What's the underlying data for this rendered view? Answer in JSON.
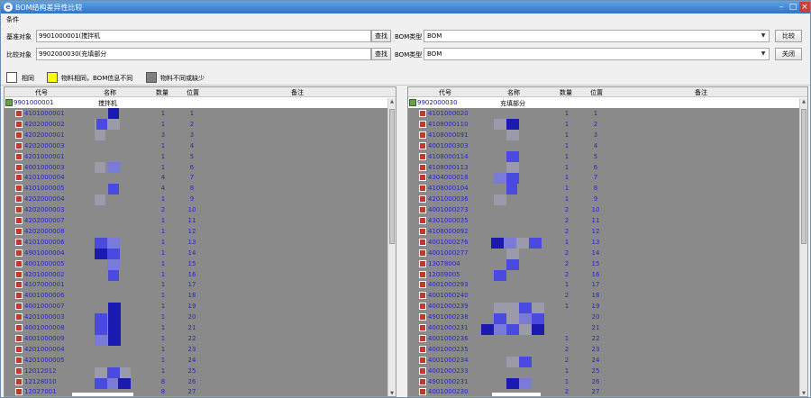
{
  "window": {
    "title": "BOM结构差异性比较",
    "minimize": "–",
    "maximize": "□",
    "close": "×"
  },
  "conditions": {
    "section_label": "条件",
    "base_label": "基准对象",
    "base_value": "9901000001(搅拌机",
    "compare_label": "比较对象",
    "compare_value": "9902000030(充填部分",
    "find_label": "查找",
    "bom_type_label": "BOM类型",
    "bom_type_value": "BOM",
    "compare_button": "比较",
    "close_button": "关闭"
  },
  "legend": [
    {
      "label": "相同",
      "color": "#ffffff"
    },
    {
      "label": "物料相同，BOM信息不同",
      "color": "#ffff00"
    },
    {
      "label": "物料不同或缺少",
      "color": "#808080"
    }
  ],
  "columns": {
    "code": "代号",
    "name": "名称",
    "qty": "数量",
    "pos": "位置",
    "remark": "备注"
  },
  "left_panel": {
    "root_code": "9901000001",
    "root_name": "搅拌机",
    "rows": [
      {
        "code": "4101000001",
        "qty": "1",
        "pos": "1"
      },
      {
        "code": "4202000002",
        "qty": "1",
        "pos": "2"
      },
      {
        "code": "4202000001",
        "qty": "3",
        "pos": "3"
      },
      {
        "code": "4202000003",
        "qty": "1",
        "pos": "4"
      },
      {
        "code": "4201000001",
        "qty": "1",
        "pos": "5"
      },
      {
        "code": "4001000003",
        "qty": "1",
        "pos": "6"
      },
      {
        "code": "4101000004",
        "qty": "4",
        "pos": "7"
      },
      {
        "code": "4101000005",
        "qty": "4",
        "pos": "8"
      },
      {
        "code": "4202000004",
        "qty": "1",
        "pos": "9"
      },
      {
        "code": "4202000003",
        "qty": "2",
        "pos": "10"
      },
      {
        "code": "4202000007",
        "qty": "1",
        "pos": "11"
      },
      {
        "code": "4202000008",
        "qty": "1",
        "pos": "12"
      },
      {
        "code": "4101000006",
        "qty": "1",
        "pos": "13"
      },
      {
        "code": "4901000004",
        "qty": "1",
        "pos": "14"
      },
      {
        "code": "4001000005",
        "qty": "1",
        "pos": "15"
      },
      {
        "code": "4201000002",
        "qty": "1",
        "pos": "16"
      },
      {
        "code": "4107000001",
        "qty": "1",
        "pos": "17"
      },
      {
        "code": "4001000006",
        "qty": "1",
        "pos": "18"
      },
      {
        "code": "4001000007",
        "qty": "1",
        "pos": "19"
      },
      {
        "code": "4201000003",
        "qty": "1",
        "pos": "20"
      },
      {
        "code": "4001000008",
        "qty": "1",
        "pos": "21"
      },
      {
        "code": "4001000009",
        "qty": "1",
        "pos": "22"
      },
      {
        "code": "4201000004",
        "qty": "1",
        "pos": "23"
      },
      {
        "code": "4201000005",
        "qty": "1",
        "pos": "24"
      },
      {
        "code": "12012012",
        "qty": "1",
        "pos": "25"
      },
      {
        "code": "12128010",
        "qty": "8",
        "pos": "26"
      },
      {
        "code": "12027001",
        "qty": "8",
        "pos": "27"
      }
    ]
  },
  "right_panel": {
    "root_code": "9902000030",
    "root_name": "充填部分",
    "rows": [
      {
        "code": "4101000020",
        "qty": "1",
        "pos": "1"
      },
      {
        "code": "4108000110",
        "qty": "1",
        "pos": "2"
      },
      {
        "code": "4108000091",
        "qty": "1",
        "pos": "3"
      },
      {
        "code": "4001000303",
        "qty": "1",
        "pos": "4"
      },
      {
        "code": "4108000114",
        "qty": "1",
        "pos": "5"
      },
      {
        "code": "4108000113",
        "qty": "1",
        "pos": "6"
      },
      {
        "code": "4304000018",
        "qty": "1",
        "pos": "7"
      },
      {
        "code": "4108000104",
        "qty": "1",
        "pos": "8"
      },
      {
        "code": "4201000036",
        "qty": "1",
        "pos": "9"
      },
      {
        "code": "4001000273",
        "qty": "2",
        "pos": "10"
      },
      {
        "code": "4301000035",
        "qty": "2",
        "pos": "11"
      },
      {
        "code": "4108000092",
        "qty": "2",
        "pos": "12"
      },
      {
        "code": "4001000276",
        "qty": "1",
        "pos": "13"
      },
      {
        "code": "4001000277",
        "qty": "2",
        "pos": "14"
      },
      {
        "code": "13078004",
        "qty": "2",
        "pos": "15"
      },
      {
        "code": "12009005",
        "qty": "2",
        "pos": "16"
      },
      {
        "code": "4001000293",
        "qty": "1",
        "pos": "17"
      },
      {
        "code": "4001000240",
        "qty": "2",
        "pos": "18"
      },
      {
        "code": "4001000239",
        "qty": "1",
        "pos": "19"
      },
      {
        "code": "4901000238",
        "qty": "",
        "pos": "20"
      },
      {
        "code": "4001000231",
        "qty": "",
        "pos": "21"
      },
      {
        "code": "4001000236",
        "qty": "1",
        "pos": "22"
      },
      {
        "code": "4001000235",
        "qty": "2",
        "pos": "23"
      },
      {
        "code": "4001000234",
        "qty": "2",
        "pos": "24"
      },
      {
        "code": "4001000233",
        "qty": "1",
        "pos": "25"
      },
      {
        "code": "4901000231",
        "qty": "1",
        "pos": "26"
      },
      {
        "code": "4001000230",
        "qty": "2",
        "pos": "27"
      }
    ]
  },
  "colors": {
    "titlebar": "#2f74c8",
    "diff_gray": "#8a8a8a",
    "code_blue": "#2626c8",
    "mosaic_dark": "#1a1ab0",
    "mosaic_mid": "#4a4ae0",
    "mosaic_light": "#7a7ad8"
  },
  "icons": {
    "app": "eos-logo-icon",
    "node": "tree-node-icon"
  }
}
